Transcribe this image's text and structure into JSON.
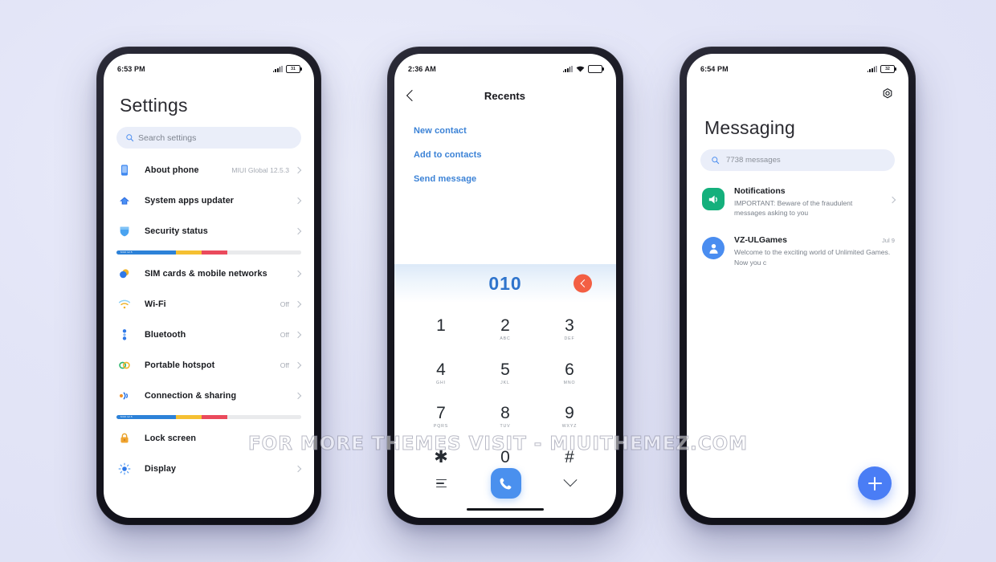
{
  "watermark": "FOR MORE THEMES VISIT - MIUITHEMEZ.COM",
  "colors": {
    "background": "#e3e5f7",
    "frame": "#16161f",
    "accent_blue": "#4a90ee",
    "link_blue": "#3b82d6",
    "dial_number": "#2f74cc",
    "delete_red": "#f35f43",
    "search_field": "#eaeef9",
    "fab_blue": "#4a7df5",
    "notif_green": "#14b07c",
    "avatar_blue": "#4a8df0"
  },
  "settings_phone": {
    "status": {
      "time": "6:53 PM",
      "battery": "31",
      "signal_icon": "signal-bars-icon",
      "battery_icon": "battery-icon"
    },
    "title": "Settings",
    "search": {
      "placeholder": "Search settings",
      "icon": "search-icon"
    },
    "items": [
      {
        "icon": "about-phone-icon",
        "label": "About phone",
        "value": "MIUI Global 12.5.3",
        "chevron": true
      },
      {
        "icon": "system-updater-icon",
        "label": "System apps updater",
        "value": "",
        "chevron": true
      },
      {
        "icon": "security-shield-icon",
        "label": "Security status",
        "value": "",
        "chevron": true
      },
      {
        "icon": "sim-cards-icon",
        "label": "SIM cards & mobile networks",
        "value": "",
        "chevron": true
      },
      {
        "icon": "wifi-icon",
        "label": "Wi-Fi",
        "value": "Off",
        "chevron": true
      },
      {
        "icon": "bluetooth-icon",
        "label": "Bluetooth",
        "value": "Off",
        "chevron": true
      },
      {
        "icon": "hotspot-icon",
        "label": "Portable hotspot",
        "value": "Off",
        "chevron": true
      },
      {
        "icon": "connection-sharing-icon",
        "label": "Connection & sharing",
        "value": "",
        "chevron": true
      },
      {
        "icon": "lock-screen-icon",
        "label": "Lock screen",
        "value": "",
        "chevron": false
      },
      {
        "icon": "display-icon",
        "label": "Display",
        "value": "",
        "chevron": true
      }
    ],
    "storage_bar": {
      "label": "MIUI 12.5",
      "segments": [
        {
          "color": "#2d82d8",
          "pct": 32
        },
        {
          "color": "#f5c032",
          "pct": 14
        },
        {
          "color": "#ea4a5c",
          "pct": 14
        },
        {
          "color": "#e9eaec",
          "pct": 40
        }
      ]
    }
  },
  "dialer_phone": {
    "status": {
      "time": "2:36 AM",
      "signal_icon": "signal-bars-icon",
      "wifi_icon": "wifi-icon",
      "battery_icon": "battery-icon"
    },
    "nav": {
      "back_icon": "back-chevron-icon",
      "title": "Recents"
    },
    "links": [
      "New contact",
      "Add to contacts",
      "Send message"
    ],
    "dialed_number": "010",
    "delete_icon": "backspace-icon",
    "keys": [
      {
        "digit": "1",
        "letters": ""
      },
      {
        "digit": "2",
        "letters": "ABC"
      },
      {
        "digit": "3",
        "letters": "DEF"
      },
      {
        "digit": "4",
        "letters": "GHI"
      },
      {
        "digit": "5",
        "letters": "JKL"
      },
      {
        "digit": "6",
        "letters": "MNO"
      },
      {
        "digit": "7",
        "letters": "PQRS"
      },
      {
        "digit": "8",
        "letters": "TUV"
      },
      {
        "digit": "9",
        "letters": "WXYZ"
      },
      {
        "digit": "✱",
        "letters": ""
      },
      {
        "digit": "0",
        "letters": ""
      },
      {
        "digit": "#",
        "letters": ""
      }
    ],
    "bottom": {
      "menu_icon": "menu-icon",
      "call_icon": "phone-call-icon",
      "collapse_icon": "chevron-down-icon"
    }
  },
  "messaging_phone": {
    "status": {
      "time": "6:54 PM",
      "battery": "32",
      "signal_icon": "signal-bars-icon",
      "battery_icon": "battery-icon"
    },
    "settings_icon": "gear-icon",
    "title": "Messaging",
    "search": {
      "placeholder": "7738 messages",
      "icon": "search-icon"
    },
    "threads": [
      {
        "avatar": "notifications-speaker-icon",
        "name": "Notifications",
        "preview": "IMPORTANT: Beware of the fraudulent messages asking to you",
        "date": "",
        "chevron": true
      },
      {
        "avatar": "contact-person-icon",
        "name": "VZ-ULGames",
        "preview": "Welcome to the exciting world of Unlimited Games. Now you c",
        "date": "Jul 9",
        "chevron": false
      }
    ],
    "fab": {
      "icon": "plus-icon",
      "label": "New message"
    }
  }
}
